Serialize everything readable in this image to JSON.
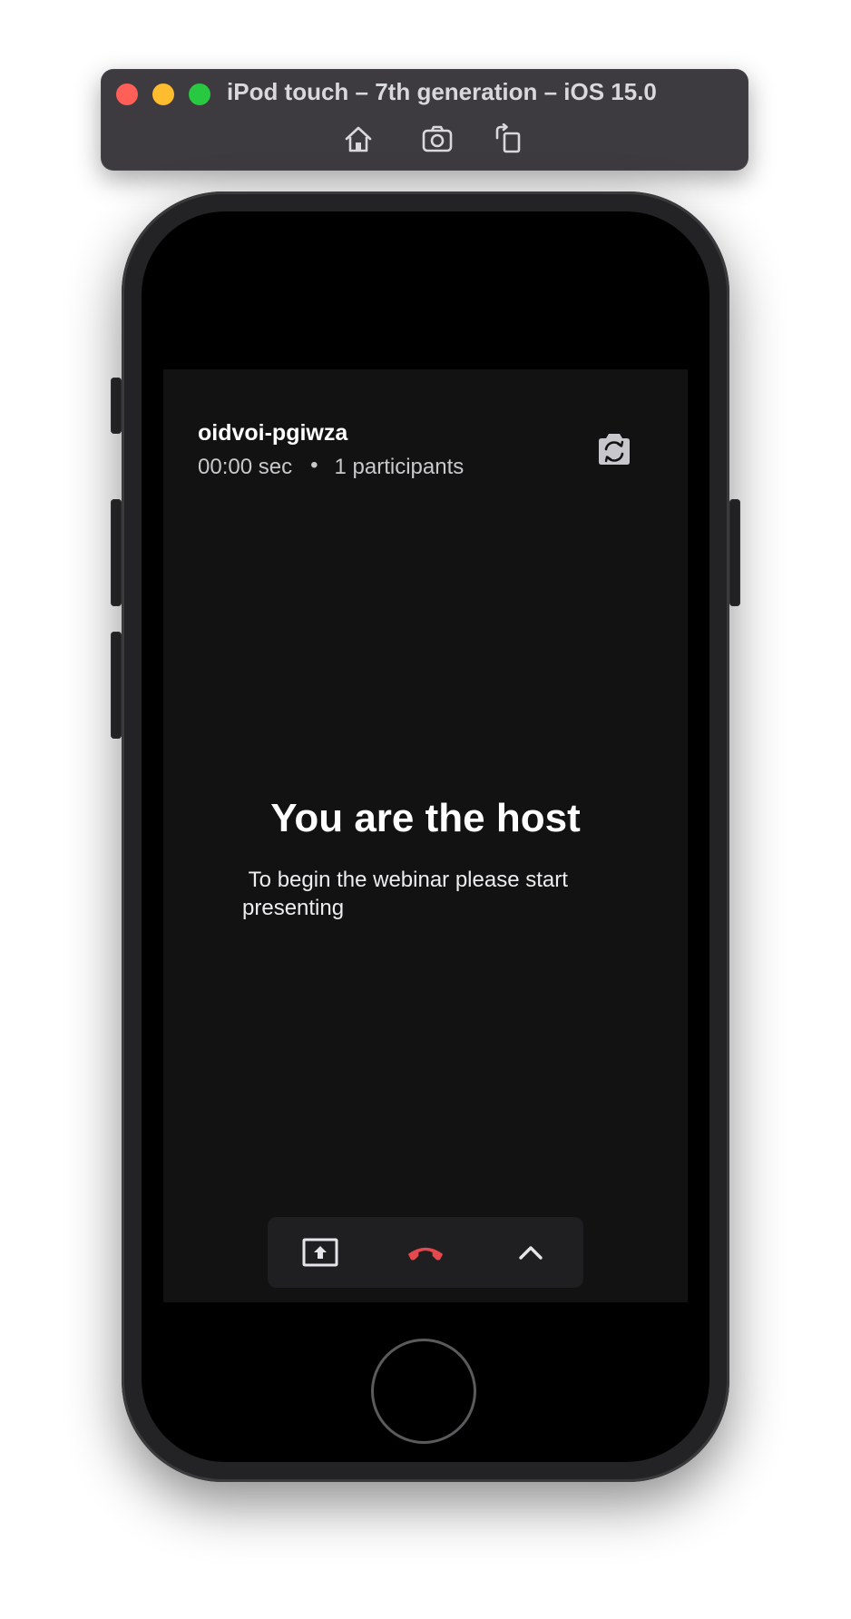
{
  "simulator": {
    "title": "iPod touch – 7th generation – iOS 15.0",
    "toolbar": [
      {
        "icon": "home-icon"
      },
      {
        "icon": "screenshot-icon"
      },
      {
        "icon": "rotate-icon"
      }
    ]
  },
  "meeting": {
    "name": "oidvoi-pgiwza",
    "duration": "00:00 sec",
    "separator": "•",
    "participants": "1 participants",
    "switch_camera_icon": "switch-camera-icon"
  },
  "main": {
    "title": "You are the host",
    "subtitle": " To begin the webinar please start presenting"
  },
  "controls": {
    "share_icon": "screen-share-icon",
    "end_icon": "end-call-icon",
    "end_color": "#e5484d",
    "more_icon": "chevron-up-icon"
  }
}
